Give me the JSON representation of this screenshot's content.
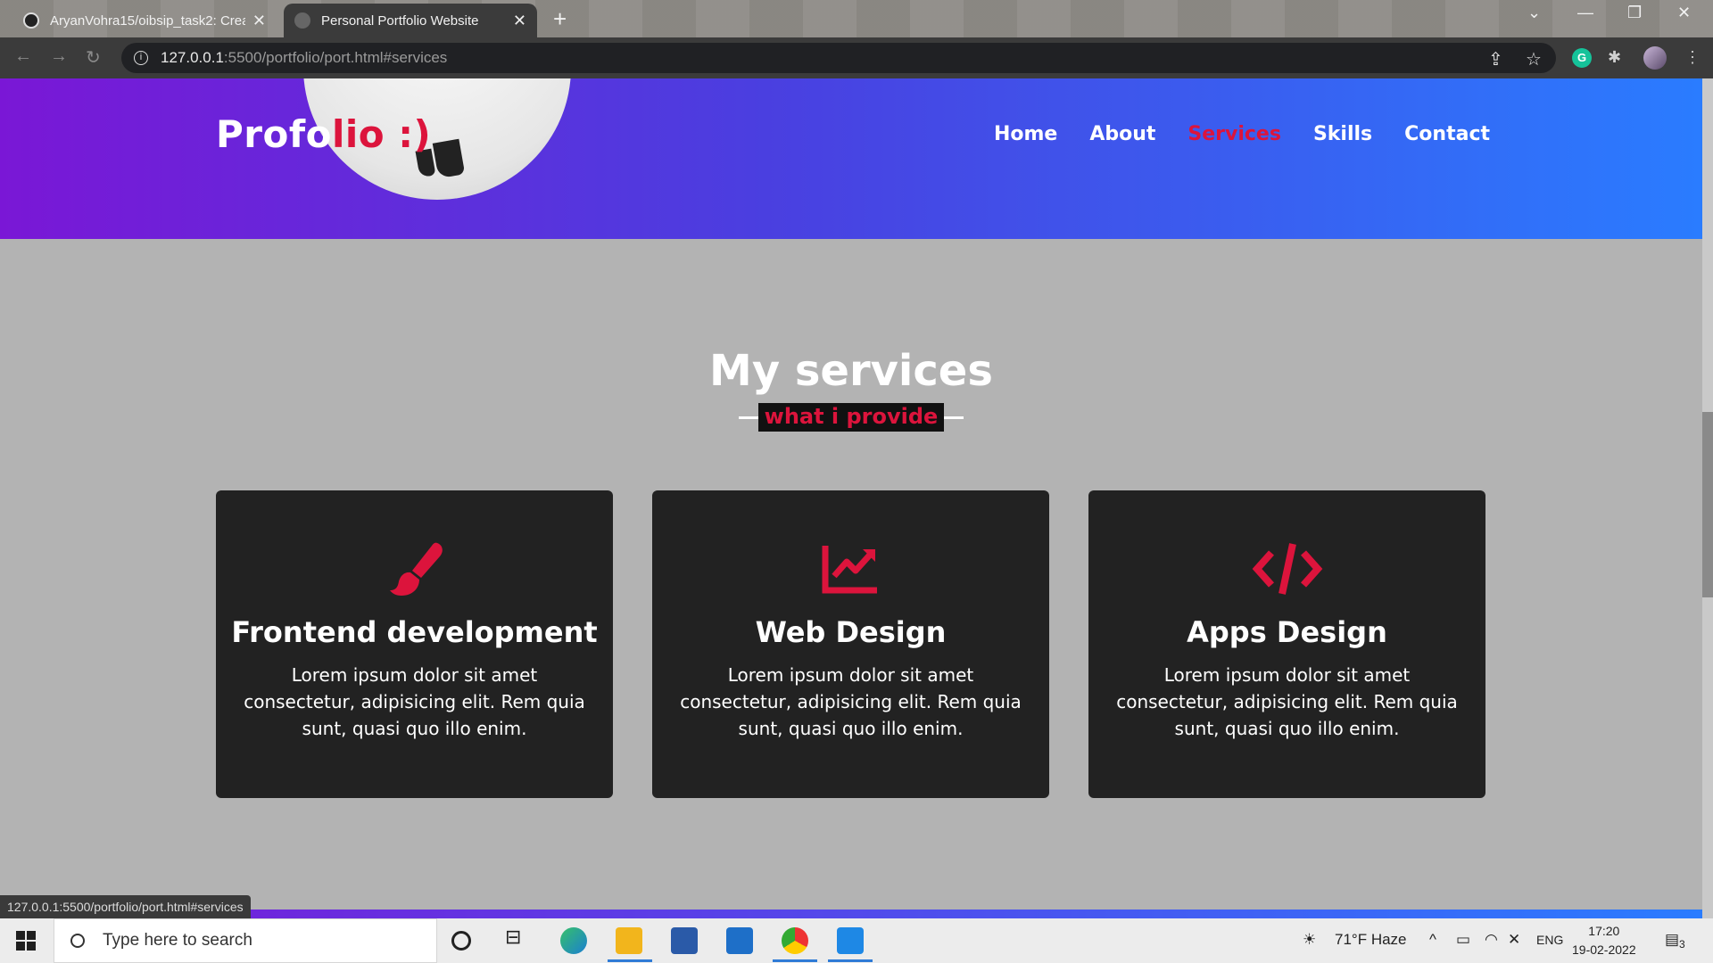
{
  "browser": {
    "tabs": [
      {
        "title": "AryanVohra15/oibsip_task2: Crea",
        "active": false
      },
      {
        "title": "Personal Portfolio Website",
        "active": true
      }
    ],
    "url_host": "127.0.0.1",
    "url_path": ":5500/portfolio/port.html#services",
    "status_url": "127.0.0.1:5500/portfolio/port.html#services"
  },
  "site": {
    "logo_main": "Profo",
    "logo_accent": "lio :)",
    "nav": [
      {
        "label": "Home",
        "active": false
      },
      {
        "label": "About",
        "active": false
      },
      {
        "label": "Services",
        "active": true
      },
      {
        "label": "Skills",
        "active": false
      },
      {
        "label": "Contact",
        "active": false
      }
    ],
    "accent_color": "#dc143c"
  },
  "services": {
    "title": "My services",
    "subtitle": "what i provide",
    "cards": [
      {
        "icon": "paint-brush-icon",
        "title": "Frontend development",
        "text": "Lorem ipsum dolor sit amet consectetur, adipisicing elit. Rem quia sunt, quasi quo illo enim."
      },
      {
        "icon": "chart-line-icon",
        "title": "Web Design",
        "text": "Lorem ipsum dolor sit amet consectetur, adipisicing elit. Rem quia sunt, quasi quo illo enim."
      },
      {
        "icon": "code-icon",
        "title": "Apps Design",
        "text": "Lorem ipsum dolor sit amet consectetur, adipisicing elit. Rem quia sunt, quasi quo illo enim."
      }
    ]
  },
  "taskbar": {
    "search_placeholder": "Type here to search",
    "weather": "71°F  Haze",
    "language": "ENG",
    "time": "17:20",
    "date": "19-02-2022",
    "notifications": "3"
  }
}
